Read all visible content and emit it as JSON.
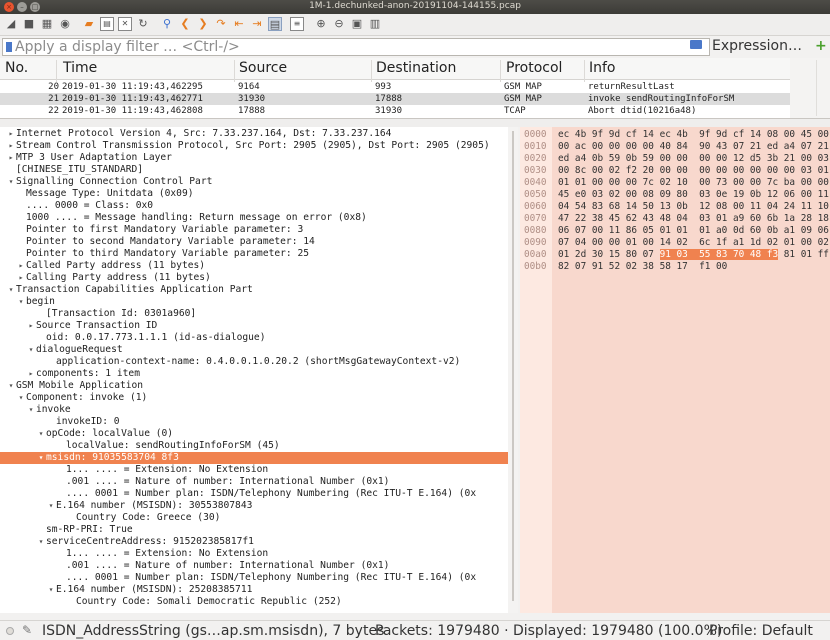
{
  "window": {
    "title": "1M-1.dechunked-anon-20191104-144155.pcap"
  },
  "filter": {
    "placeholder": "Apply a display filter … <Ctrl-/>",
    "expression_label": "Expression…",
    "plus": "+"
  },
  "packet_list": {
    "columns": [
      "No.",
      "Time",
      "Source",
      "Destination",
      "Protocol",
      "Info"
    ],
    "rows": [
      {
        "no": "20",
        "time": "2019-01-30 11:19:43,462295",
        "src": "9164",
        "dst": "993",
        "proto": "GSM MAP",
        "info": "returnResultLast"
      },
      {
        "no": "21",
        "time": "2019-01-30 11:19:43,462771",
        "src": "31930",
        "dst": "17888",
        "proto": "GSM MAP",
        "info": "invoke sendRoutingInfoForSM",
        "selected": true
      },
      {
        "no": "22",
        "time": "2019-01-30 11:19:43,462808",
        "src": "17888",
        "dst": "31930",
        "proto": "TCAP",
        "info": "Abort dtid(10216a48)"
      }
    ]
  },
  "detail": [
    {
      "ind": 0,
      "tw": ">",
      "text": "Internet Protocol Version 4, Src: 7.33.237.164, Dst: 7.33.237.164"
    },
    {
      "ind": 0,
      "tw": ">",
      "text": "Stream Control Transmission Protocol, Src Port: 2905 (2905), Dst Port: 2905 (2905)"
    },
    {
      "ind": 0,
      "tw": ">",
      "text": "MTP 3 User Adaptation Layer"
    },
    {
      "ind": 0,
      "tw": "",
      "text": "[CHINESE_ITU_STANDARD]"
    },
    {
      "ind": 0,
      "tw": "v",
      "text": "Signalling Connection Control Part"
    },
    {
      "ind": 1,
      "tw": "",
      "text": "Message Type: Unitdata (0x09)"
    },
    {
      "ind": 1,
      "tw": "",
      "text": ".... 0000 = Class: 0x0"
    },
    {
      "ind": 1,
      "tw": "",
      "text": "1000 .... = Message handling: Return message on error (0x8)"
    },
    {
      "ind": 1,
      "tw": "",
      "text": "Pointer to first Mandatory Variable parameter: 3"
    },
    {
      "ind": 1,
      "tw": "",
      "text": "Pointer to second Mandatory Variable parameter: 14"
    },
    {
      "ind": 1,
      "tw": "",
      "text": "Pointer to third Mandatory Variable parameter: 25"
    },
    {
      "ind": 1,
      "tw": ">",
      "text": "Called Party address (11 bytes)"
    },
    {
      "ind": 1,
      "tw": ">",
      "text": "Calling Party address (11 bytes)"
    },
    {
      "ind": 0,
      "tw": "v",
      "text": "Transaction Capabilities Application Part"
    },
    {
      "ind": 1,
      "tw": "v",
      "text": "begin"
    },
    {
      "ind": 3,
      "tw": "",
      "text": "[Transaction Id: 0301a960]"
    },
    {
      "ind": 2,
      "tw": ">",
      "text": "Source Transaction ID"
    },
    {
      "ind": 3,
      "tw": "",
      "text": "oid: 0.0.17.773.1.1.1 (id-as-dialogue)"
    },
    {
      "ind": 2,
      "tw": "v",
      "text": "dialogueRequest"
    },
    {
      "ind": 4,
      "tw": "",
      "text": "application-context-name: 0.4.0.0.1.0.20.2 (shortMsgGatewayContext-v2)"
    },
    {
      "ind": 2,
      "tw": ">",
      "text": "components: 1 item"
    },
    {
      "ind": 0,
      "tw": "v",
      "text": "GSM Mobile Application"
    },
    {
      "ind": 1,
      "tw": "v",
      "text": "Component: invoke (1)"
    },
    {
      "ind": 2,
      "tw": "v",
      "text": "invoke"
    },
    {
      "ind": 4,
      "tw": "",
      "text": "invokeID: 0"
    },
    {
      "ind": 3,
      "tw": "v",
      "text": "opCode: localValue (0)"
    },
    {
      "ind": 5,
      "tw": "",
      "text": "localValue: sendRoutingInfoForSM (45)"
    },
    {
      "ind": 3,
      "tw": "v",
      "text": "msisdn: 91035583704 8f3",
      "selected": true
    },
    {
      "ind": 5,
      "tw": "",
      "text": "1... .... = Extension: No Extension"
    },
    {
      "ind": 5,
      "tw": "",
      "text": ".001 .... = Nature of number: International Number (0x1)"
    },
    {
      "ind": 5,
      "tw": "",
      "text": ".... 0001 = Number plan: ISDN/Telephony Numbering (Rec ITU-T E.164) (0x"
    },
    {
      "ind": 4,
      "tw": "v",
      "text": "E.164 number (MSISDN): 30553807843"
    },
    {
      "ind": 6,
      "tw": "",
      "text": "Country Code: Greece (30)"
    },
    {
      "ind": 3,
      "tw": "",
      "text": "sm-RP-PRI: True"
    },
    {
      "ind": 3,
      "tw": "v",
      "text": "serviceCentreAddress: 915202385817f1"
    },
    {
      "ind": 5,
      "tw": "",
      "text": "1... .... = Extension: No Extension"
    },
    {
      "ind": 5,
      "tw": "",
      "text": ".001 .... = Nature of number: International Number (0x1)"
    },
    {
      "ind": 5,
      "tw": "",
      "text": ".... 0001 = Number plan: ISDN/Telephony Numbering (Rec ITU-T E.164) (0x"
    },
    {
      "ind": 4,
      "tw": "v",
      "text": "E.164 number (MSISDN): 25208385711"
    },
    {
      "ind": 6,
      "tw": "",
      "text": "Country Code: Somali Democratic Republic (252)"
    }
  ],
  "bytes": [
    {
      "off": "0000",
      "hex": "ec 4b 9f 9d cf 14 ec 4b  9f 9d cf 14 08 00 45 00"
    },
    {
      "off": "0010",
      "hex": "00 ac 00 00 00 00 40 84  90 43 07 21 ed a4 07 21"
    },
    {
      "off": "0020",
      "hex": "ed a4 0b 59 0b 59 00 00  00 00 12 d5 3b 21 00 03"
    },
    {
      "off": "0030",
      "hex": "00 8c 00 02 f2 20 00 00  00 00 00 00 00 00 03 01 00"
    },
    {
      "off": "0040",
      "hex": "01 01 00 00 00 7c 02 10  00 73 00 00 7c ba 00 00"
    },
    {
      "off": "0050",
      "hex": "45 e0 03 02 00 08 09 80  03 0e 19 0b 12 06 00 11"
    },
    {
      "off": "0060",
      "hex": "04 54 83 68 14 50 13 0b  12 08 00 11 04 24 11 10"
    },
    {
      "off": "0070",
      "hex": "47 22 38 45 62 43 48 04  03 01 a9 60 6b 1a 28 18"
    },
    {
      "off": "0080",
      "hex": "06 07 00 11 86 05 01 01  01 a0 0d 60 0b a1 09 06"
    },
    {
      "off": "0090",
      "hex": "07 04 00 00 01 00 14 02  6c 1f a1 1d 02 01 00 02"
    },
    {
      "off": "00a0",
      "hex": "01 2d 30 15 80 07 91 03  55 83 70 48 f3 81 01 ff"
    },
    {
      "off": "00b0",
      "hex": "82 07 91 52 02 38 58 17  f1 00"
    }
  ],
  "bytes_highlight": "91 03  55 83 70 48 f3",
  "status": {
    "field": "ISDN_AddressString (gs…ap.sm.msisdn), 7 bytes",
    "packets": "Packets: 1979480 · Displayed: 1979480 (100.0%)",
    "profile": "Profile: Default"
  }
}
